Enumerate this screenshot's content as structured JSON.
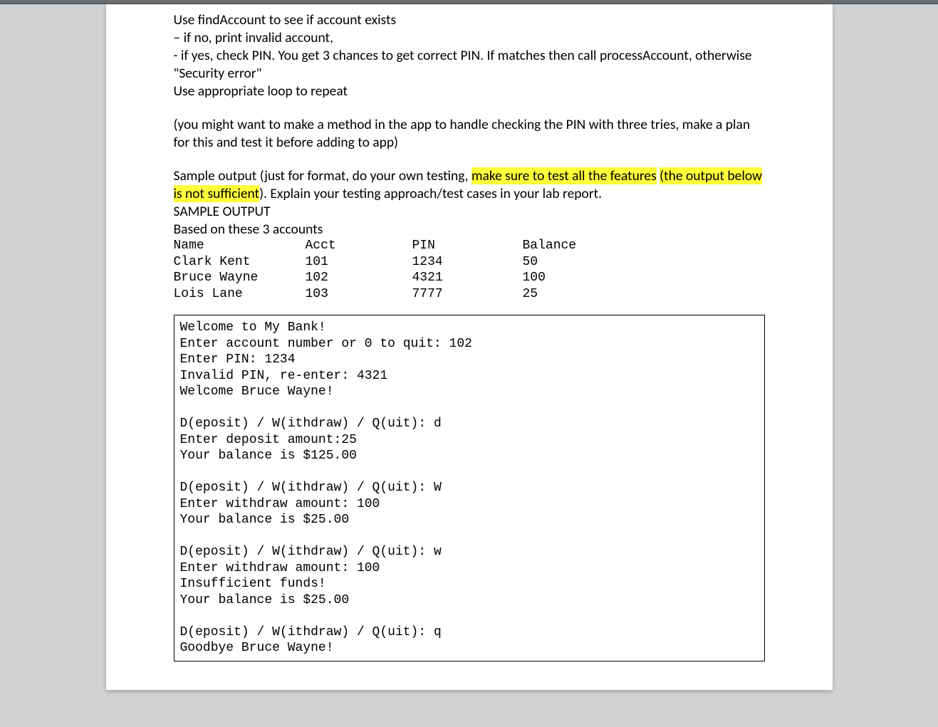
{
  "instructions": {
    "line1": "Use findAccount to see if account exists",
    "line2": " – if no, print invalid account,",
    "line3": " -  if yes, check PIN.  You get 3 chances to get correct PIN. If matches then call processAccount, otherwise \"Security error\"",
    "line4": "Use appropriate loop to repeat",
    "note": "(you might want to make a method in the app to handle checking the PIN with three tries, make a plan for this and test it before adding to app)",
    "sample_intro_pre": "Sample output (just for format, do your own testing, ",
    "sample_intro_hl1": "make sure to test all the features",
    "sample_intro_hl2": "(the output below is not sufficient",
    "sample_intro_post1": ").  Explain your testing approach/test cases in your lab report.",
    "sample_output_label": "SAMPLE OUTPUT",
    "based_on": "Based on these 3 accounts"
  },
  "table": {
    "headers": {
      "name": "Name",
      "acct": "Acct",
      "pin": "PIN",
      "balance": "Balance"
    },
    "rows": [
      {
        "name": "Clark Kent",
        "acct": "101",
        "pin": "1234",
        "balance": "50"
      },
      {
        "name": "Bruce Wayne",
        "acct": "102",
        "pin": "4321",
        "balance": "100"
      },
      {
        "name": "Lois Lane",
        "acct": "103",
        "pin": "7777",
        "balance": "25"
      }
    ]
  },
  "output_lines": [
    "Welcome to My Bank!",
    "Enter account number or 0 to quit: 102",
    "Enter PIN: 1234",
    "Invalid PIN, re-enter: 4321",
    "Welcome Bruce Wayne!",
    "",
    "D(eposit) / W(ithdraw) / Q(uit): d",
    "Enter deposit amount:25",
    "Your balance is $125.00",
    "",
    "D(eposit) / W(ithdraw) / Q(uit): W",
    "Enter withdraw amount: 100",
    "Your balance is $25.00",
    "",
    "D(eposit) / W(ithdraw) / Q(uit): w",
    "Enter withdraw amount: 100",
    "Insufficient funds!",
    "Your balance is $25.00",
    "",
    "D(eposit) / W(ithdraw) / Q(uit): q",
    "Goodbye Bruce Wayne!"
  ]
}
